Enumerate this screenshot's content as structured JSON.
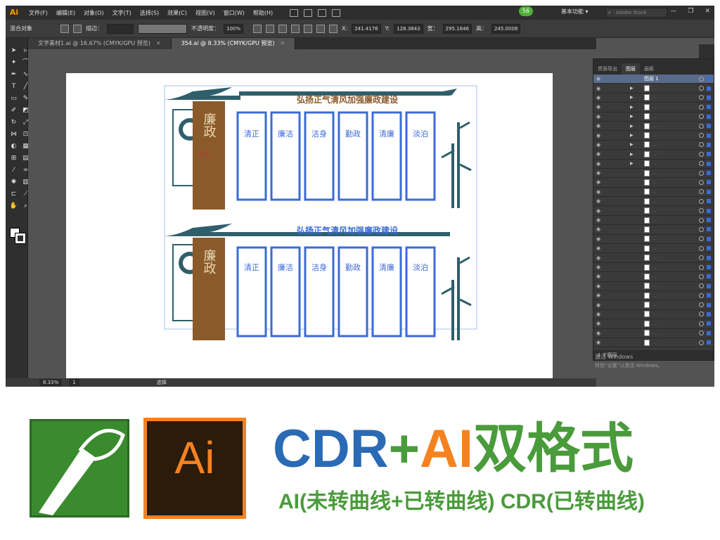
{
  "app": {
    "logo": "Ai",
    "badge": "56"
  },
  "menu": [
    "文件(F)",
    "编辑(E)",
    "对象(O)",
    "文字(T)",
    "选择(S)",
    "效果(C)",
    "视图(V)",
    "窗口(W)",
    "帮助(H)"
  ],
  "workspace": "基本功能 ▾",
  "search": {
    "placeholder": "Adobe Stock"
  },
  "control": {
    "mode": "混合对象",
    "stroke_label": "描边：",
    "opacity_label": "不透明度：",
    "opacity_value": "100%",
    "x_label": "X:",
    "x_value": "241.4176",
    "y_label": "Y:",
    "y_value": "128.3843",
    "w_label": "宽：",
    "w_value": "295.1846",
    "h_label": "高：",
    "h_value": "245.0008"
  },
  "tabs": [
    {
      "label": "文字素材1.ai @ 16.67% (CMYK/GPU 预览)"
    },
    {
      "label": "354.ai @ 8.33% (CMYK/GPU 预览)"
    }
  ],
  "status": {
    "zoom": "8.33%",
    "page": "1",
    "tool": "选择"
  },
  "panel": {
    "tabs": [
      "资源导出",
      "图层",
      "画板"
    ],
    "layer_name": "图层 1",
    "footer": "1 个图层"
  },
  "activate": {
    "line1": "激活 Windows",
    "line2": "转到“设置”以激活 Windows。"
  },
  "artwork": {
    "banner": "弘扬正气清风加强廉政建设",
    "feature": "廉政",
    "feature_sub": "文化",
    "panels": [
      "清正",
      "廉洁",
      "洁身",
      "勤政",
      "清廉",
      "淡泊"
    ]
  },
  "promo": {
    "cdr": "CDR",
    "plus": "+",
    "ai": "AI",
    "format": "双格式",
    "sub": "AI(未转曲线+已转曲线) CDR(已转曲线)",
    "ai_logo": "Ai"
  },
  "colors": {
    "accent": "#2b6ab5",
    "orange": "#f58220",
    "green": "#4a9b3b",
    "panel_blue": "#3b6bd6",
    "brown": "#8b5a2b",
    "teal": "#2f5f6a"
  }
}
